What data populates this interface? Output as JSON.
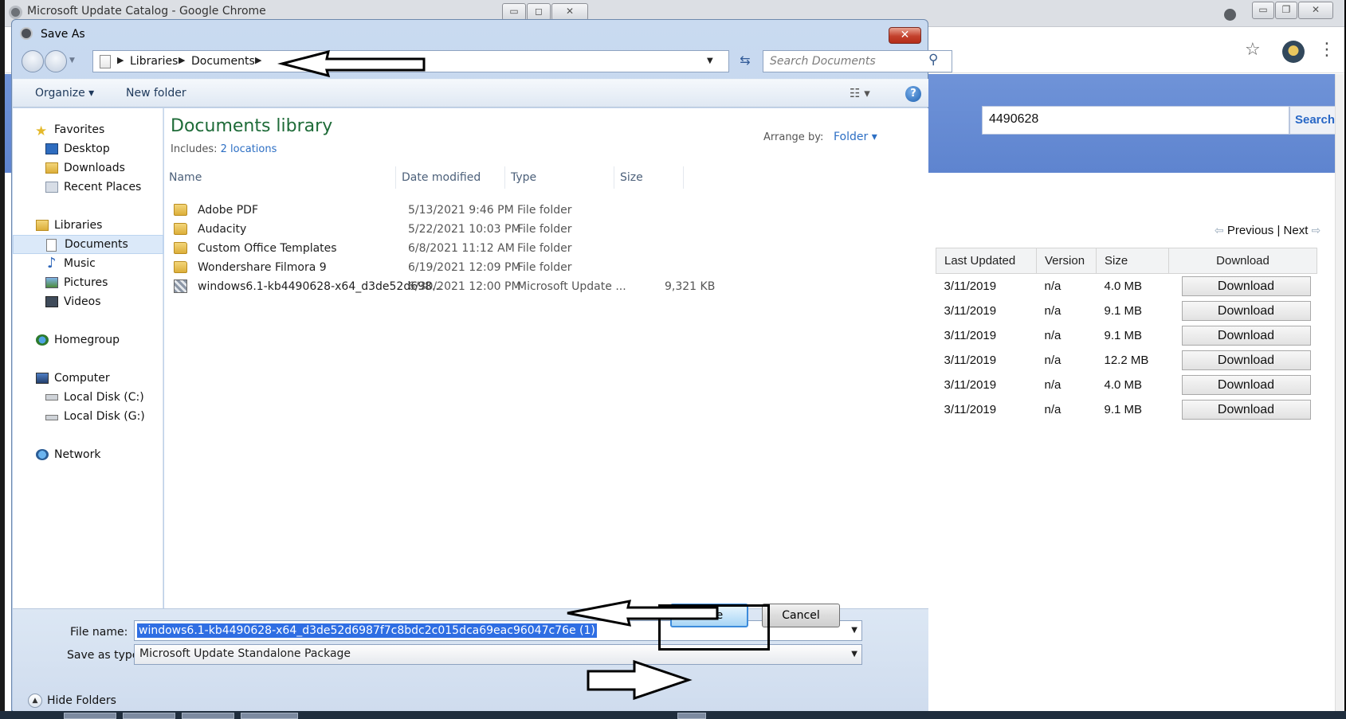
{
  "chrome": {
    "title": "Microsoft Update Catalog - Google Chrome",
    "search_value": "4490628",
    "search_button": "Search",
    "pager_previous": "Previous",
    "pager_sep": "|",
    "pager_next": "Next",
    "table": {
      "headers": [
        "Last Updated",
        "Version",
        "Size",
        "Download"
      ],
      "rows": [
        {
          "date": "3/11/2019",
          "version": "n/a",
          "size": "4.0 MB",
          "action": "Download"
        },
        {
          "date": "3/11/2019",
          "version": "n/a",
          "size": "9.1 MB",
          "action": "Download"
        },
        {
          "date": "3/11/2019",
          "version": "n/a",
          "size": "9.1 MB",
          "action": "Download"
        },
        {
          "date": "3/11/2019",
          "version": "n/a",
          "size": "12.2 MB",
          "action": "Download"
        },
        {
          "date": "3/11/2019",
          "version": "n/a",
          "size": "4.0 MB",
          "action": "Download"
        },
        {
          "date": "3/11/2019",
          "version": "n/a",
          "size": "9.1 MB",
          "action": "Download"
        }
      ]
    }
  },
  "dialog": {
    "title": "Save As",
    "breadcrumb": [
      "Libraries",
      "Documents"
    ],
    "search_placeholder": "Search Documents",
    "toolbar": {
      "organize": "Organize ▾",
      "new_folder": "New folder"
    },
    "nav": {
      "favorites": "Favorites",
      "desktop": "Desktop",
      "downloads": "Downloads",
      "recent": "Recent Places",
      "libraries": "Libraries",
      "documents": "Documents",
      "music": "Music",
      "pictures": "Pictures",
      "videos": "Videos",
      "homegroup": "Homegroup",
      "computer": "Computer",
      "local_c": "Local Disk (C:)",
      "local_g": "Local Disk (G:)",
      "network": "Network"
    },
    "library_title": "Documents library",
    "includes_label": "Includes:",
    "includes_link": "2 locations",
    "arrange_label": "Arrange by:",
    "arrange_value": "Folder ▾",
    "columns": [
      "Name",
      "Date modified",
      "Type",
      "Size"
    ],
    "files": [
      {
        "name": "Adobe PDF",
        "date": "5/13/2021 9:46 PM",
        "type": "File folder",
        "size": ""
      },
      {
        "name": "Audacity",
        "date": "5/22/2021 10:03 PM",
        "type": "File folder",
        "size": ""
      },
      {
        "name": "Custom Office Templates",
        "date": "6/8/2021 11:12 AM",
        "type": "File folder",
        "size": ""
      },
      {
        "name": "Wondershare Filmora 9",
        "date": "6/19/2021 12:09 PM",
        "type": "File folder",
        "size": ""
      },
      {
        "name": "windows6.1-kb4490628-x64_d3de52d698...",
        "date": "6/30/2021 12:00 PM",
        "type": "Microsoft Update ...",
        "size": "9,321 KB"
      }
    ],
    "filename_label": "File name:",
    "filename_value": "windows6.1-kb4490628-x64_d3de52d6987f7c8bdc2c015dca69eac96047c76e (1)",
    "savetype_label": "Save as type:",
    "savetype_value": "Microsoft Update Standalone Package",
    "hide_folders": "Hide Folders",
    "save": "Save",
    "cancel": "Cancel"
  }
}
